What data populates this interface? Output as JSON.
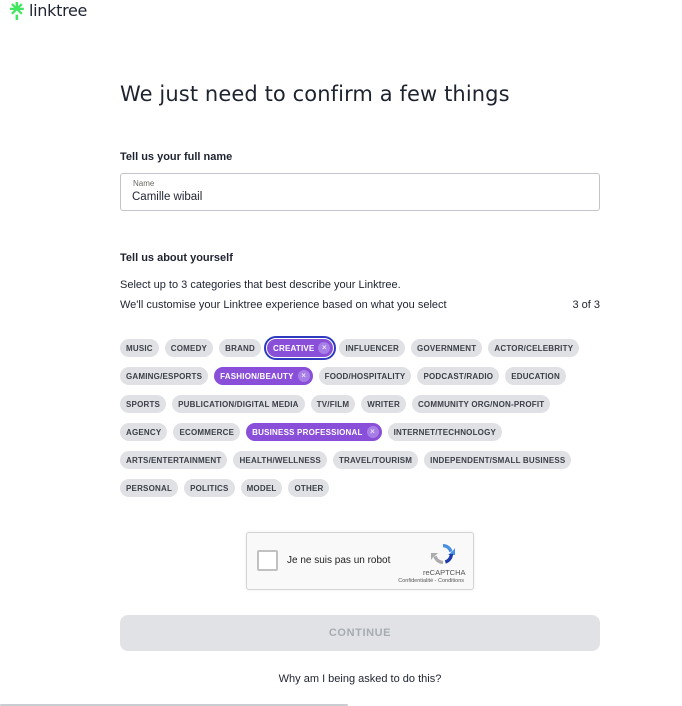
{
  "brand": {
    "name": "linktree",
    "color": "#43e660"
  },
  "page_title": "We just need to confirm a few things",
  "name_section": {
    "label": "Tell us your full name",
    "field_label": "Name",
    "field_value": "Camille wibail"
  },
  "about_section": {
    "label": "Tell us about yourself",
    "line1": "Select up to 3 categories that best describe your Linktree.",
    "line2": "We'll customise your Linktree experience based on what you select",
    "counter": "3 of 3"
  },
  "categories": [
    [
      {
        "label": "MUSIC"
      },
      {
        "label": "COMEDY"
      },
      {
        "label": "BRAND"
      },
      {
        "label": "CREATIVE",
        "selected": true,
        "focused": true
      },
      {
        "label": "INFLUENCER"
      },
      {
        "label": "GOVERNMENT"
      },
      {
        "label": "ACTOR/CELEBRITY"
      }
    ],
    [
      {
        "label": "GAMING/ESPORTS"
      },
      {
        "label": "FASHION/BEAUTY",
        "selected": true
      },
      {
        "label": "FOOD/HOSPITALITY"
      },
      {
        "label": "PODCAST/RADIO"
      },
      {
        "label": "EDUCATION"
      }
    ],
    [
      {
        "label": "SPORTS"
      },
      {
        "label": "PUBLICATION/DIGITAL MEDIA"
      },
      {
        "label": "TV/FILM"
      },
      {
        "label": "WRITER"
      },
      {
        "label": "COMMUNITY ORG/NON-PROFIT"
      }
    ],
    [
      {
        "label": "AGENCY"
      },
      {
        "label": "ECOMMERCE"
      },
      {
        "label": "BUSINESS PROFESSIONAL",
        "selected": true
      },
      {
        "label": "INTERNET/TECHNOLOGY"
      }
    ],
    [
      {
        "label": "ARTS/ENTERTAINMENT"
      },
      {
        "label": "HEALTH/WELLNESS"
      },
      {
        "label": "TRAVEL/TOURISM"
      },
      {
        "label": "INDEPENDENT/SMALL BUSINESS"
      }
    ],
    [
      {
        "label": "PERSONAL"
      },
      {
        "label": "POLITICS"
      },
      {
        "label": "MODEL"
      },
      {
        "label": "OTHER"
      }
    ]
  ],
  "captcha": {
    "label": "Je ne suis pas un robot",
    "brand": "reCAPTCHA",
    "links": "Confidentialité - Conditions"
  },
  "continue_label": "CONTINUE",
  "help_link": "Why am I being asked to do this?",
  "colors": {
    "accent": "#8a4fd8",
    "chip_bg": "#dfe1e4",
    "button_disabled": "#e0e2e5"
  }
}
